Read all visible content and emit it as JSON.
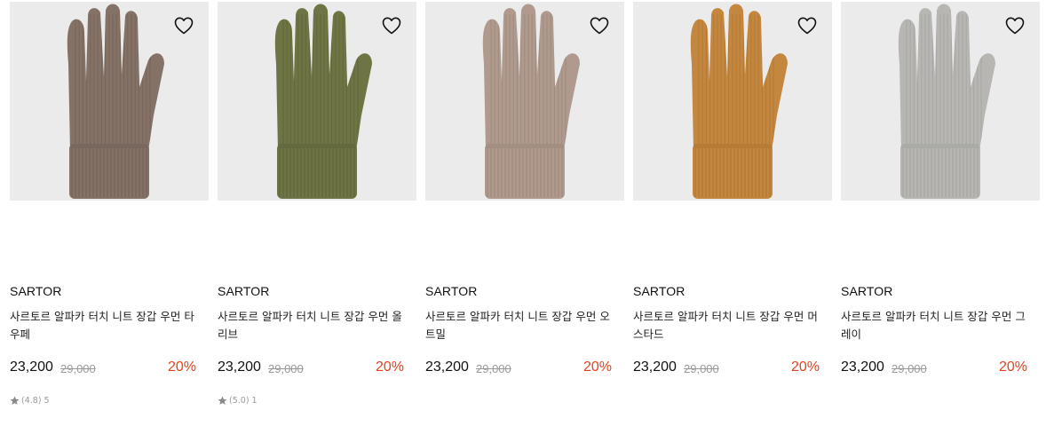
{
  "products": [
    {
      "brand": "SARTOR",
      "name": "사르토르 알파카 터치 니트 장갑 우먼 타우페",
      "price": "23,200",
      "original_price": "29,000",
      "discount": "20%",
      "rating": "(4.8)",
      "review_count": "5",
      "color": "#857267",
      "color_dark": "#6e5d53",
      "wishlist_icon": "heart-outline-icon"
    },
    {
      "brand": "SARTOR",
      "name": "사르토르 알파카 터치 니트 장갑 우먼 올리브",
      "price": "23,200",
      "original_price": "29,000",
      "discount": "20%",
      "rating": "(5.0)",
      "review_count": "1",
      "color": "#6f7444",
      "color_dark": "#5a5f35",
      "wishlist_icon": "heart-outline-icon"
    },
    {
      "brand": "SARTOR",
      "name": "사르토르 알파카 터치 니트 장갑 우먼 오트밀",
      "price": "23,200",
      "original_price": "29,000",
      "discount": "20%",
      "color": "#b09a8e",
      "color_dark": "#968276",
      "wishlist_icon": "heart-outline-icon"
    },
    {
      "brand": "SARTOR",
      "name": "사르토르 알파카 터치 니트 장갑 우먼 머스타드",
      "price": "23,200",
      "original_price": "29,000",
      "discount": "20%",
      "color": "#c4873f",
      "color_dark": "#a96f2e",
      "wishlist_icon": "heart-outline-icon"
    },
    {
      "brand": "SARTOR",
      "name": "사르토르 알파카 터치 니트 장갑 우먼 그레이",
      "price": "23,200",
      "original_price": "29,000",
      "discount": "20%",
      "color": "#b7b6b3",
      "color_dark": "#9e9d9a",
      "wishlist_icon": "heart-outline-icon"
    }
  ],
  "colors": {
    "thumb_background": "#ebebeb",
    "discount": "#e0431f",
    "original_price": "#9a9a9a",
    "rating_text": "#999999"
  }
}
